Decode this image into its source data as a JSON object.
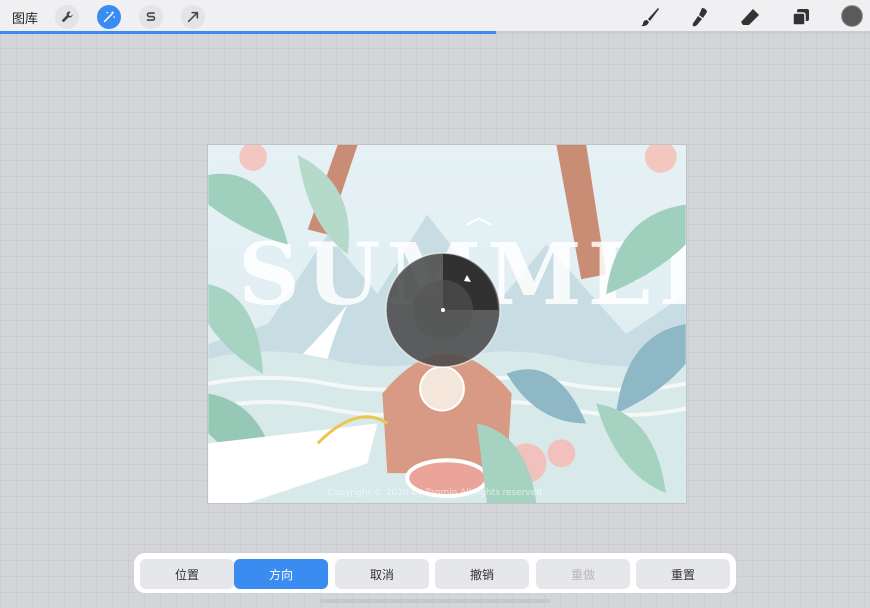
{
  "topbar": {
    "gallery_label": "图库",
    "left_tools": [
      {
        "icon": "wrench-icon",
        "active": false
      },
      {
        "icon": "magic-wand-icon",
        "active": true
      },
      {
        "icon": "selection-s-icon",
        "active": false
      },
      {
        "icon": "transform-arrow-icon",
        "active": false
      }
    ],
    "right_tools": [
      "brush-icon",
      "smudge-icon",
      "eraser-icon",
      "layers-icon"
    ],
    "current_color": "#5a5a5a",
    "progress": 0.57
  },
  "canvas": {
    "art_text": "SUMMER",
    "watermark": "Copyright © 2020 by Tanmin All rights reserved"
  },
  "actionbar": {
    "buttons": [
      {
        "label": "位置",
        "state": "normal"
      },
      {
        "label": "方向",
        "state": "active"
      },
      {
        "label": "取消",
        "state": "normal"
      },
      {
        "label": "撤销",
        "state": "normal"
      },
      {
        "label": "重做",
        "state": "disabled"
      },
      {
        "label": "重置",
        "state": "normal"
      }
    ]
  },
  "colors": {
    "accent": "#3a8cf0",
    "toolbar_bg": "#f0f0f2",
    "workspace_bg": "#d3d5d9"
  }
}
